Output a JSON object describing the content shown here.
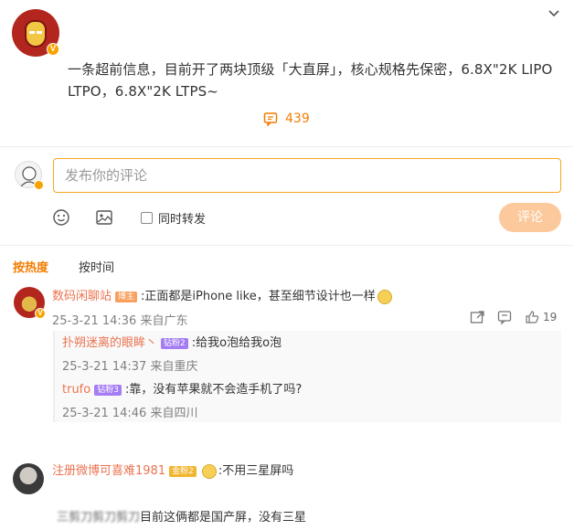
{
  "post": {
    "text": "一条超前信息，目前开了两块顶级「大直屏」，核心规格先保密，6.8X\"2K LIPO LTPO，6.8X\"2K LTPS~",
    "comment_count": "439",
    "verified_badge": "V"
  },
  "composer": {
    "placeholder": "发布你的评论",
    "repost_label": "同时转发",
    "submit_label": "评论"
  },
  "sort": {
    "hot": "按热度",
    "time": "按时间"
  },
  "comments": [
    {
      "user": "数码闲聊站",
      "tag": "博主",
      "text": ":正面都是iPhone like，甚至细节设计也一样",
      "meta": "25-3-21 14:36 来自广东",
      "likes": "19",
      "replies": [
        {
          "user": "扑朔迷离的眼眸丶",
          "tag": "钻粉2",
          "text": ":给我o泡给我o泡",
          "meta": "25-3-21 14:37 来自重庆"
        },
        {
          "user": "trufo",
          "tag": "钻粉3",
          "text": ":靠，没有苹果就不会造手机了吗?",
          "meta": "25-3-21 14:46 来自四川"
        }
      ]
    },
    {
      "user": "注册微博可喜难1981",
      "tag": "金粉2",
      "text": ":不用三星屏吗",
      "sub_user": "三剪刀剪刀剪刀",
      "sub_text": "目前这俩都是国产屏，没有三星"
    }
  ],
  "colors": {
    "accent": "#f57c00",
    "username": "#eb7350",
    "submit_bg": "#fcc99c",
    "input_border": "#f5a623"
  }
}
